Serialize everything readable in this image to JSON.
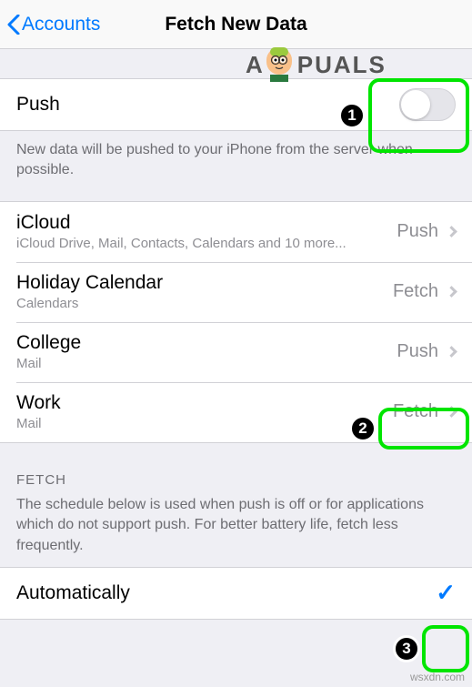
{
  "nav": {
    "back": "Accounts",
    "title": "Fetch New Data"
  },
  "watermark": {
    "text_left": "A",
    "text_right": "PUALS"
  },
  "push": {
    "label": "Push",
    "desc": "New data will be pushed to your iPhone from the server when possible."
  },
  "accounts": [
    {
      "name": "iCloud",
      "sub": "iCloud Drive, Mail, Contacts, Calendars and 10 more...",
      "mode": "Push"
    },
    {
      "name": "Holiday Calendar",
      "sub": "Calendars",
      "mode": "Fetch"
    },
    {
      "name": "College",
      "sub": "Mail",
      "mode": "Push"
    },
    {
      "name": "Work",
      "sub": "Mail",
      "mode": "Fetch"
    }
  ],
  "fetch": {
    "header": "FETCH",
    "desc": "The schedule below is used when push is off or for applications which do not support push. For better battery life, fetch less frequently.",
    "option": "Automatically"
  },
  "annot": {
    "n1": "1",
    "n2": "2",
    "n3": "3"
  },
  "credit": "wsxdn.com"
}
